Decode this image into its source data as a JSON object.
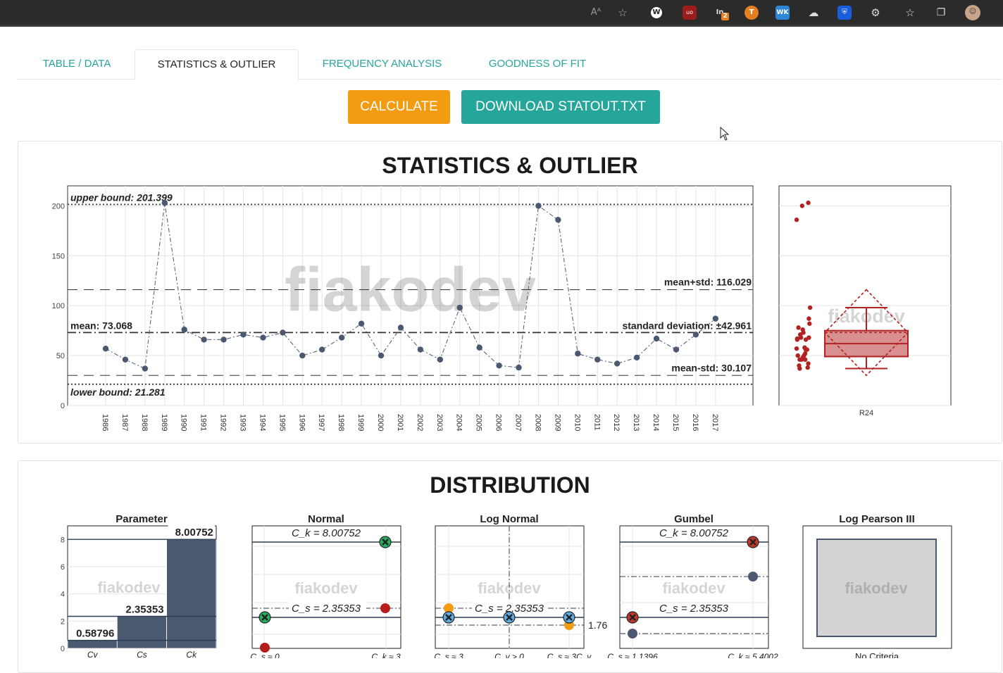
{
  "browser": {
    "icons": [
      "read-aloud-icon",
      "add-favorite-icon",
      "w-extension-icon",
      "ublock-icon",
      "extension-badge-icon",
      "t-extension-icon",
      "wk-extension-icon",
      "cloud-icon",
      "bitwarden-icon",
      "extensions-icon",
      "favorites-icon",
      "collections-icon",
      "profile-avatar-icon"
    ],
    "badge": "2"
  },
  "tabs": [
    {
      "label": "TABLE / DATA"
    },
    {
      "label": "STATISTICS & OUTLIER"
    },
    {
      "label": "FREQUENCY ANALYSIS"
    },
    {
      "label": "GOODNESS OF FIT"
    }
  ],
  "actions": {
    "calculate": "CALCULATE",
    "download": "DOWNLOAD STATOUT.TXT"
  },
  "colors": {
    "teal": "#26a69a",
    "orange": "#f39c12",
    "series": "#4a5870",
    "outlier": "#b22222"
  },
  "stats_panel": {
    "title": "STATISTICS & OUTLIER"
  },
  "dist_panel": {
    "title": "DISTRIBUTION"
  },
  "watermark": "fiakodev",
  "chart_data": [
    {
      "type": "line",
      "title": "",
      "x": [
        1986,
        1987,
        1988,
        1989,
        1990,
        1991,
        1992,
        1993,
        1994,
        1995,
        1996,
        1997,
        1998,
        1999,
        2000,
        2001,
        2002,
        2003,
        2004,
        2005,
        2006,
        2007,
        2008,
        2009,
        2010,
        2011,
        2012,
        2013,
        2014,
        2015,
        2016,
        2017
      ],
      "values": [
        57,
        46,
        37,
        203,
        76,
        66,
        66,
        71,
        68,
        73,
        50,
        56,
        68,
        82,
        50,
        78,
        56,
        46,
        98,
        58,
        40,
        38,
        200,
        186,
        52,
        46,
        42,
        48,
        67,
        56,
        71,
        87
      ],
      "ylim": [
        0,
        220
      ],
      "yticks": [
        0,
        50,
        100,
        150,
        200
      ],
      "hlines": [
        {
          "label": "upper bound: 201.399",
          "value": 201.399,
          "style": "dotted"
        },
        {
          "label": "mean+std: 116.029",
          "value": 116.029,
          "style": "dashed"
        },
        {
          "label": "mean: 73.068",
          "value": 73.068,
          "style": "dashdot"
        },
        {
          "label": "standard deviation: ±42.961",
          "value": 73.068,
          "style": "none"
        },
        {
          "label": "mean-std: 30.107",
          "value": 30.107,
          "style": "dashed"
        },
        {
          "label": "lower bound: 21.281",
          "value": 21.281,
          "style": "dotted"
        }
      ],
      "grid": true
    },
    {
      "type": "box",
      "category": "R24",
      "values": [
        57,
        46,
        37,
        203,
        76,
        66,
        66,
        71,
        68,
        73,
        50,
        56,
        68,
        82,
        50,
        78,
        56,
        46,
        98,
        58,
        40,
        38,
        200,
        186,
        52,
        46,
        42,
        48,
        67,
        56,
        71,
        87
      ],
      "ylim": [
        0,
        220
      ],
      "box": {
        "q1": 49,
        "median": 62,
        "q3": 75,
        "whisker_low": 37,
        "whisker_high": 98,
        "mean": 73.068,
        "std": 42.961
      }
    },
    {
      "type": "bar",
      "title": "Parameter",
      "categories": [
        "Cv",
        "Cs",
        "Ck"
      ],
      "values": [
        0.58796,
        2.35353,
        8.00752
      ],
      "labels": [
        "0.58796",
        "2.35353",
        "8.00752"
      ],
      "ylim": [
        0,
        9
      ],
      "yticks": [
        0,
        2,
        4,
        6,
        8
      ]
    },
    {
      "type": "scatter",
      "title": "Normal",
      "annotations": [
        "C_k = 8.00752",
        "C_s = 2.35353"
      ],
      "bottom_labels": [
        "C_s ≈ 0",
        "C_k ≈ 3"
      ]
    },
    {
      "type": "scatter",
      "title": "Log Normal",
      "annotations": [
        "C_s = 2.35353",
        "1.76"
      ],
      "bottom_labels": [
        "C_s ≈ 3",
        "C_v > 0",
        "C_s ≈ 3C_v"
      ]
    },
    {
      "type": "scatter",
      "title": "Gumbel",
      "annotations": [
        "C_k = 8.00752",
        "C_s = 2.35353"
      ],
      "bottom_labels": [
        "C_s ≈ 1.1396",
        "C_k ≈ 5.4002"
      ]
    },
    {
      "type": "table",
      "title": "Log Pearson III",
      "bottom_labels": [
        "No Criteria"
      ]
    }
  ]
}
